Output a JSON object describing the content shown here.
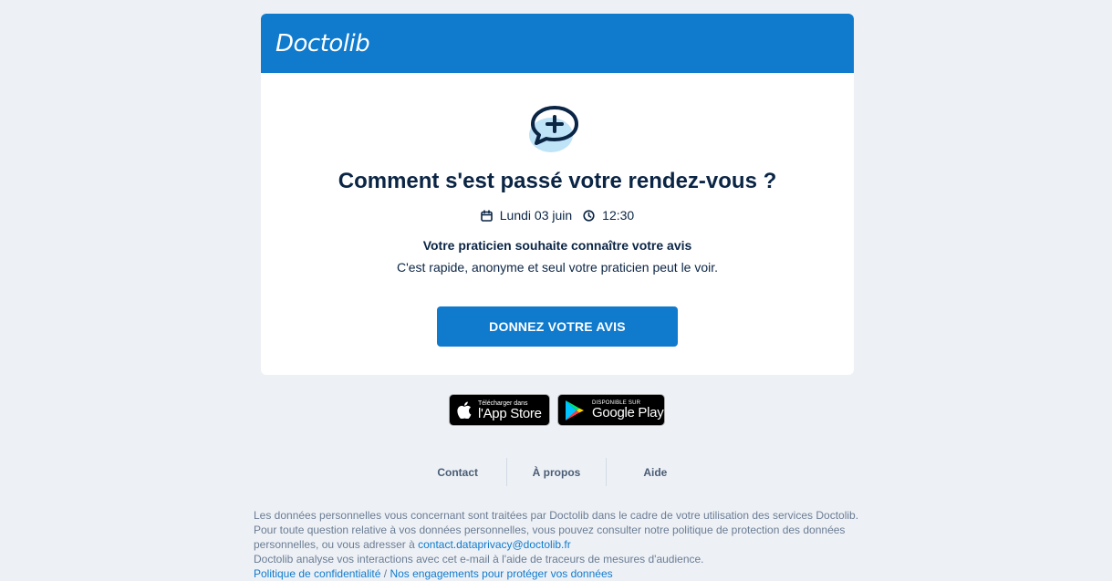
{
  "header": {
    "logo_text": "Doctolib"
  },
  "main": {
    "hero_icon": "speech-bubble-plus-icon",
    "title": "Comment s'est passé votre rendez-vous ?",
    "date": "Lundi 03 juin",
    "time": "12:30",
    "subtitle": "Votre praticien souhaite connaître votre avis",
    "description": "C'est rapide, anonyme et seul votre praticien peut le voir.",
    "cta_label": "DONNEZ VOTRE AVIS"
  },
  "stores": {
    "apple_small": "Télécharger dans",
    "apple_big": "l'App Store",
    "google_small": "DISPONIBLE SUR",
    "google_big": "Google Play"
  },
  "footer": {
    "links": [
      "Contact",
      "À propos",
      "Aide"
    ],
    "legal": {
      "line1": "Les données personnelles vous concernant sont traitées par Doctolib dans le cadre de votre utilisation des services Doctolib.",
      "line2_text": "Pour toute question relative à vos données personnelles, vous pouvez consulter notre politique de protection des données personnelles, ou vous adresser à ",
      "line2_email": "contact.dataprivacy@doctolib.fr",
      "line3": "Doctolib analyse vos interactions avec cet e-mail à l'aide de traceurs de mesures d'audience.",
      "privacy_link": "Politique de confidentialité",
      "separator": " / ",
      "commitments_link": "Nos engagements pour protéger vos données"
    }
  },
  "colors": {
    "brand": "#107acc",
    "text": "#0b2545",
    "background": "#edf1f6"
  }
}
